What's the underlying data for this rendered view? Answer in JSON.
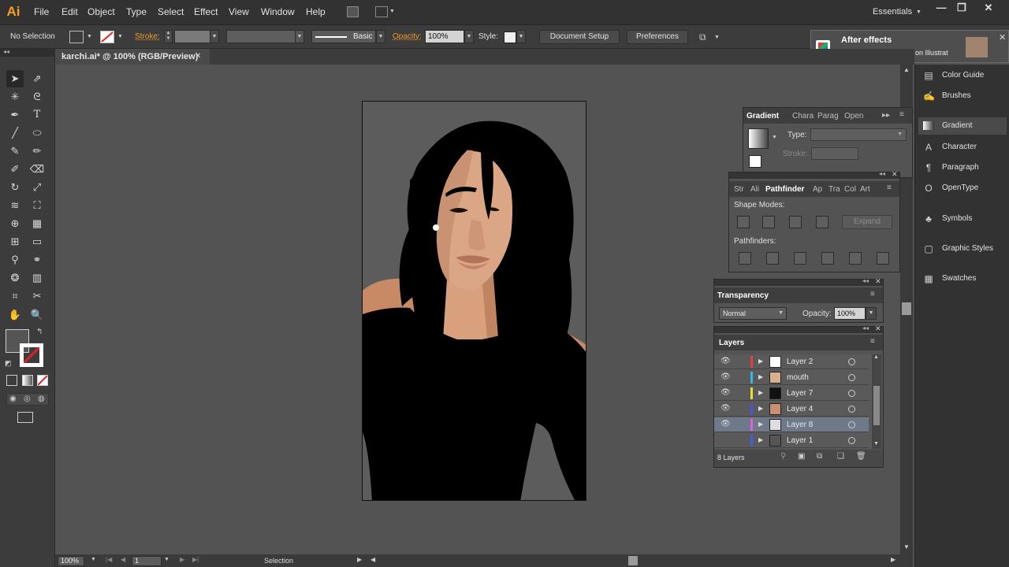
{
  "menubar": {
    "logo": "Ai",
    "items": [
      "File",
      "Edit",
      "Object",
      "Type",
      "Select",
      "Effect",
      "View",
      "Window",
      "Help"
    ],
    "workspace": "Essentials",
    "window_controls": [
      "minimize-icon",
      "restore-icon",
      "close-icon"
    ]
  },
  "controlbar": {
    "selection_status": "No Selection",
    "stroke_label": "Stroke:",
    "brush_definition": "Basic",
    "opacity_label": "Opacity:",
    "opacity_value": "100%",
    "style_label": "Style:",
    "document_setup_label": "Document Setup",
    "preferences_label": "Preferences"
  },
  "notification": {
    "title": "After effects",
    "subtitle": "Setup Trifold Brochure on Illustrat"
  },
  "document": {
    "tab_title": "karchi.ai* @ 100% (RGB/Preview)",
    "tab_close": "×"
  },
  "statusbar": {
    "zoom": "100%",
    "artboard_number": "1",
    "current_tool": "Selection"
  },
  "right_dock": {
    "items": [
      {
        "label": "Color Guide",
        "icon": "color-guide-icon"
      },
      {
        "label": "Brushes",
        "icon": "brushes-icon"
      },
      {
        "label": "Gradient",
        "icon": "gradient-icon"
      },
      {
        "label": "Character",
        "icon": "character-icon"
      },
      {
        "label": "Paragraph",
        "icon": "paragraph-icon"
      },
      {
        "label": "OpenType",
        "icon": "opentype-icon"
      },
      {
        "label": "Symbols",
        "icon": "symbols-icon"
      },
      {
        "label": "Graphic Styles",
        "icon": "graphic-styles-icon"
      },
      {
        "label": "Swatches",
        "icon": "swatches-icon"
      }
    ]
  },
  "gradient_panel": {
    "tabs": [
      "Gradient",
      "Chara",
      "Parag",
      "Open"
    ],
    "type_label": "Type:",
    "stroke_label": "Stroke:"
  },
  "pathfinder_panel": {
    "tabs": [
      "Str",
      "Ali",
      "Pathfinder",
      "Ap",
      "Tra",
      "Col",
      "Art"
    ],
    "shape_modes_label": "Shape Modes:",
    "expand_label": "Expand",
    "pathfinders_label": "Pathfinders:"
  },
  "transparency_panel": {
    "title": "Transparency",
    "blend_mode": "Normal",
    "opacity_label": "Opacity:",
    "opacity_value": "100%"
  },
  "layers_panel": {
    "title": "Layers",
    "layers": [
      {
        "name": "Layer 2",
        "color": "#e04040"
      },
      {
        "name": "mouth",
        "color": "#30b8e8"
      },
      {
        "name": "Layer 7",
        "color": "#e8e030"
      },
      {
        "name": "Layer 4",
        "color": "#5050e0"
      },
      {
        "name": "Layer 8",
        "color": "#e060e0"
      },
      {
        "name": "Layer 1",
        "color": "#4060e0"
      }
    ],
    "selected_layer": "Layer 8",
    "count_label": "8 Layers"
  }
}
